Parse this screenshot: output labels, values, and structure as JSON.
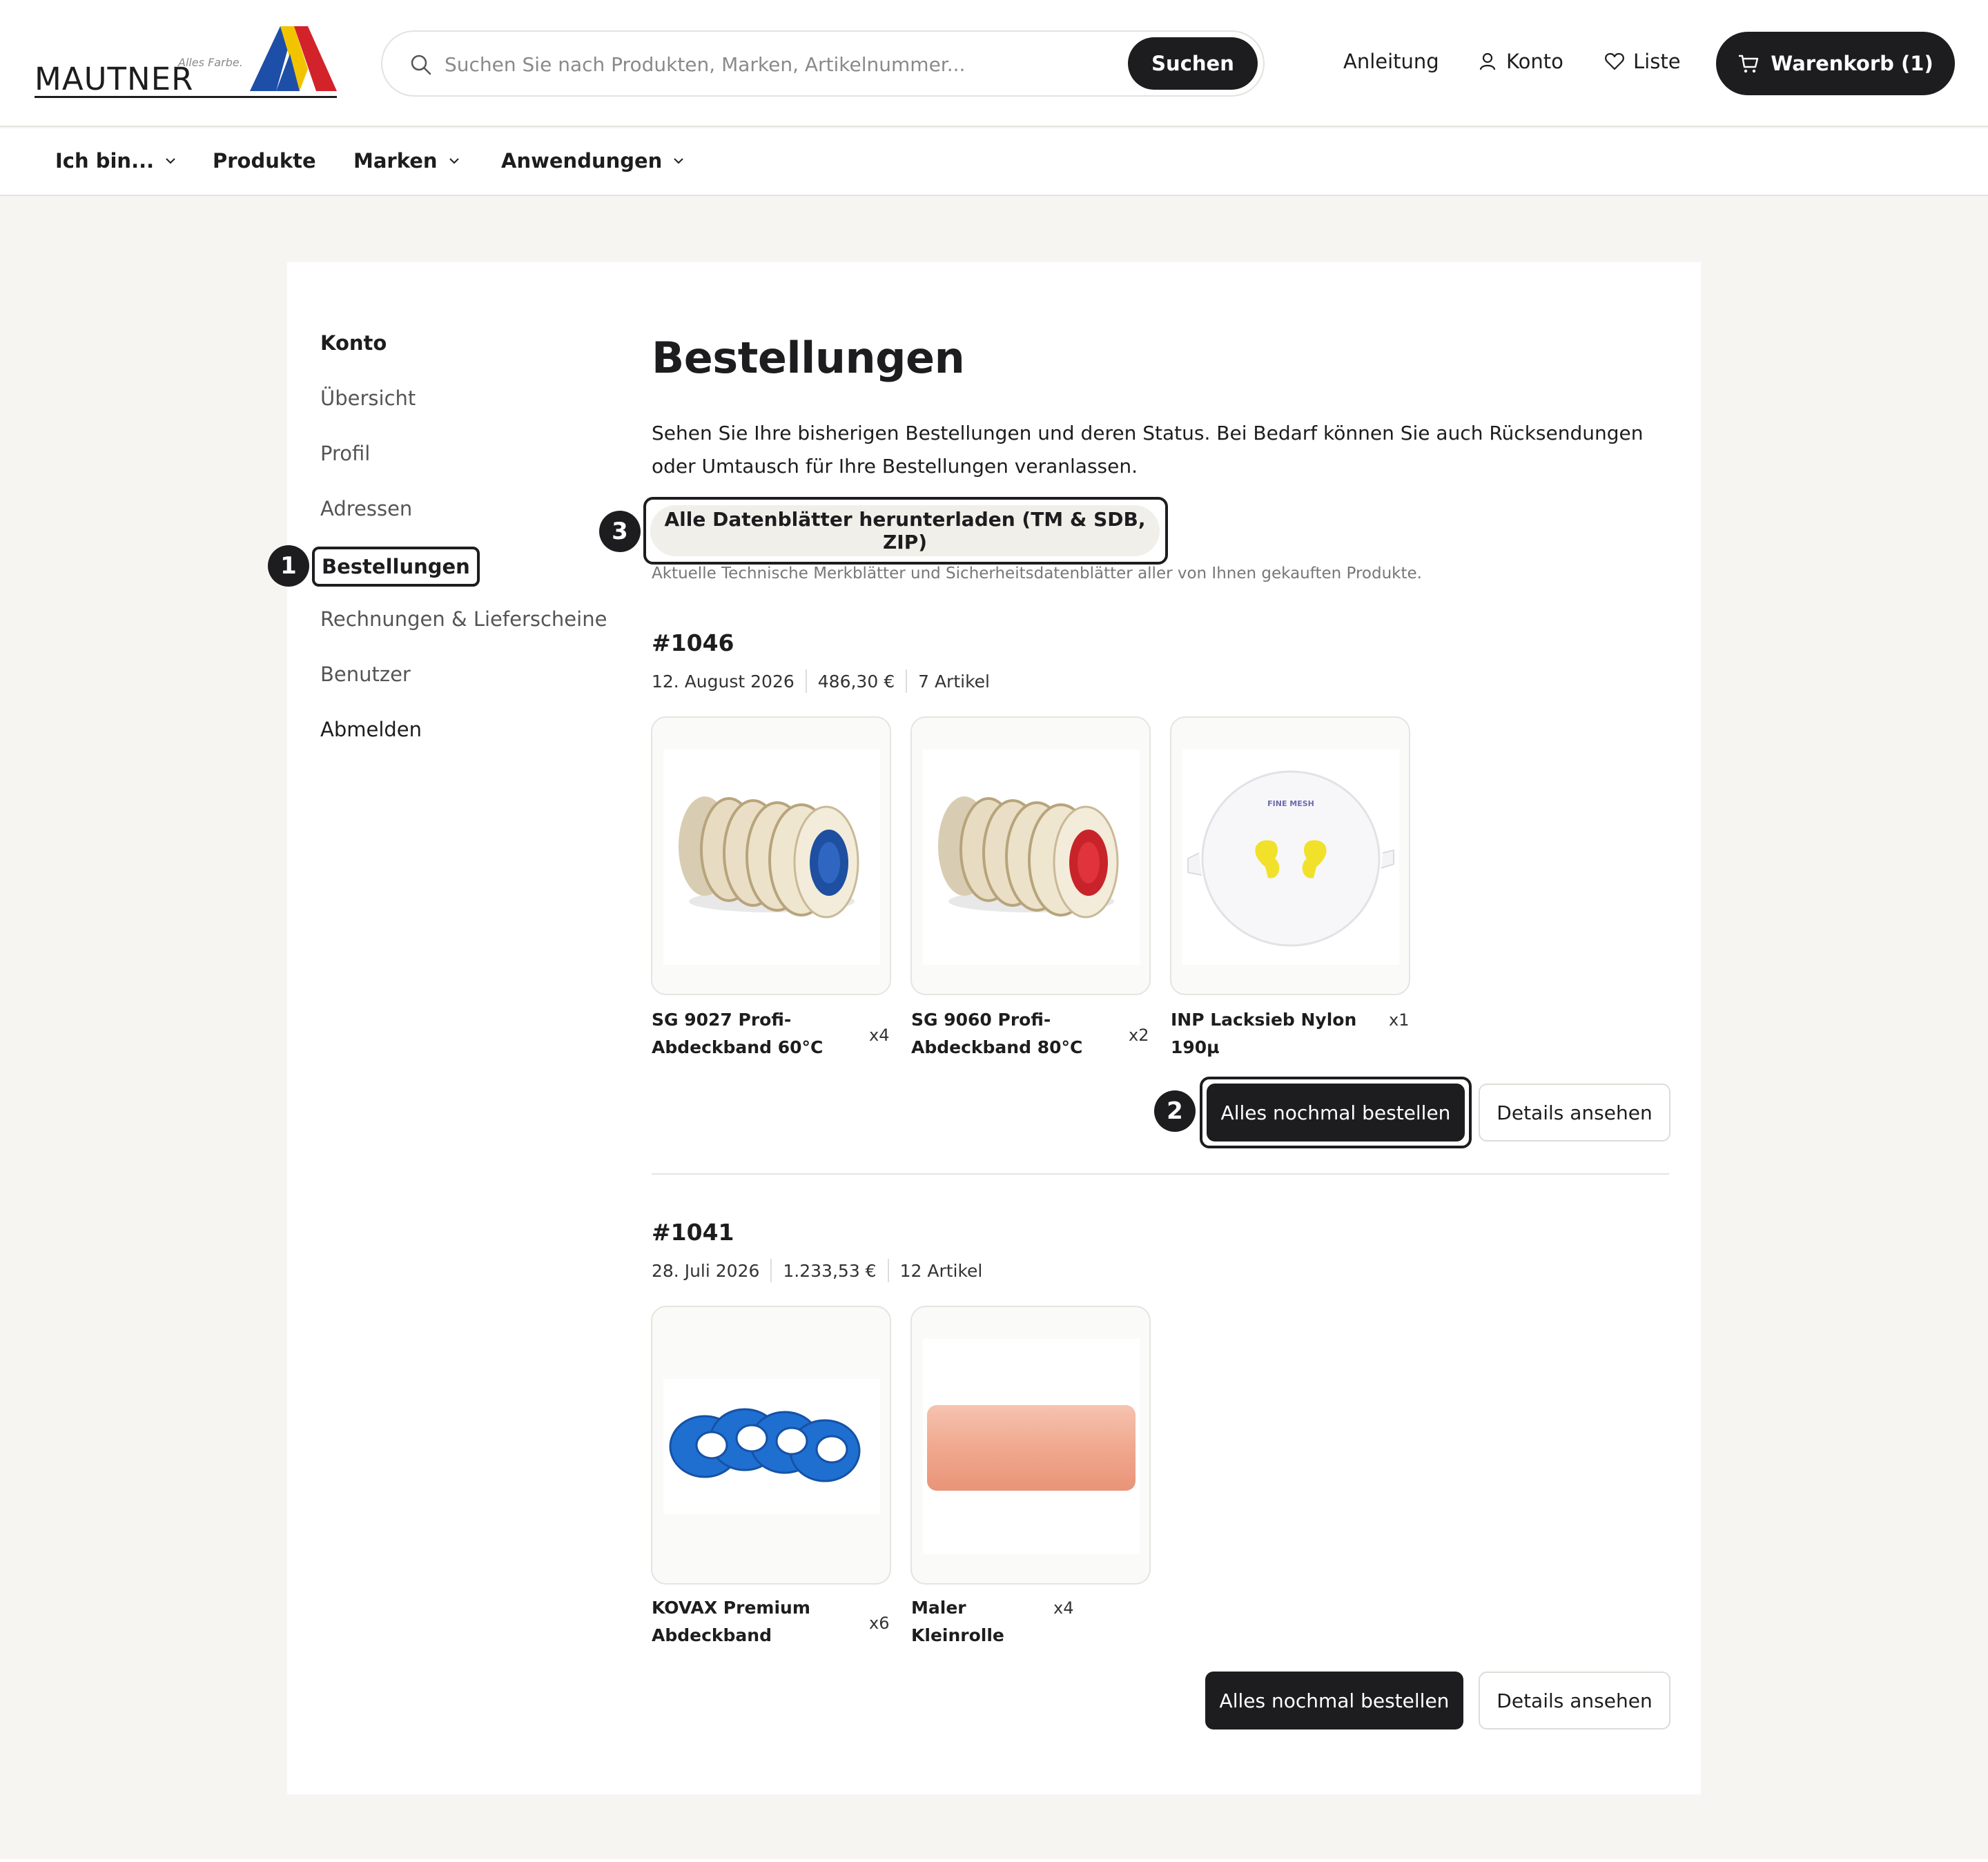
{
  "brand": {
    "name": "MAUTNER",
    "tagline": "Alles Farbe."
  },
  "search": {
    "placeholder": "Suchen Sie nach Produkten, Marken, Artikelnummer...",
    "button": "Suchen"
  },
  "header": {
    "guide": "Anleitung",
    "account": "Konto",
    "wishlist": "Liste",
    "cart": "Warenkorb (1)"
  },
  "nav": {
    "iam": "Ich bin...",
    "products": "Produkte",
    "brands": "Marken",
    "applications": "Anwendungen"
  },
  "sidebar": {
    "heading": "Konto",
    "overview": "Übersicht",
    "profile": "Profil",
    "addresses": "Adressen",
    "orders": "Bestellungen",
    "invoices": "Rechnungen & Lieferscheine",
    "users": "Benutzer",
    "logout": "Abmelden"
  },
  "badges": {
    "one": "1",
    "two": "2",
    "three": "3"
  },
  "page": {
    "title": "Bestellungen",
    "description": "Sehen Sie Ihre bisherigen Bestellungen und deren Status. Bei Bedarf können Sie auch Rücksendungen oder Umtausch für Ihre Bestellungen veranlassen.",
    "download_button": "Alle Datenblätter herunterladen (TM & SDB, ZIP)",
    "download_note": "Aktuelle Technische Merkblätter und Sicherheitsdatenblätter aller von Ihnen gekauften Produkte."
  },
  "orders": [
    {
      "id": "#1046",
      "date": "12. August 2026",
      "total": "486,30 €",
      "items_count": "7 Artikel",
      "products": [
        {
          "name": "SG 9027 Profi-Abdeckband 60°C",
          "qty": "x4",
          "icon": "masking-tape-blue-core"
        },
        {
          "name": "SG 9060 Profi-Abdeckband 80°C",
          "qty": "x2",
          "icon": "masking-tape-red-core"
        },
        {
          "name": "INP Lacksieb Nylon 190µ",
          "qty": "x1",
          "icon": "paint-strainer",
          "label": "FINE MESH"
        }
      ],
      "reorder": "Alles nochmal bestellen",
      "details": "Details ansehen"
    },
    {
      "id": "#1041",
      "date": "28. Juli 2026",
      "total": "1.233,53 €",
      "items_count": "12 Artikel",
      "products": [
        {
          "name": "KOVAX Premium Abdeckband",
          "qty": "x6",
          "icon": "blue-tape-rolls"
        },
        {
          "name": "Maler Kleinrolle",
          "qty": "x4",
          "icon": "paint-roller-sleeve"
        }
      ],
      "reorder": "Alles nochmal bestellen",
      "details": "Details ansehen"
    }
  ],
  "colors": {
    "dark": "#1d1d1f",
    "page_bg": "#f6f5f2",
    "logo_blue": "#1d4ea8",
    "logo_red": "#d2232a",
    "logo_yellow": "#f2c400"
  }
}
